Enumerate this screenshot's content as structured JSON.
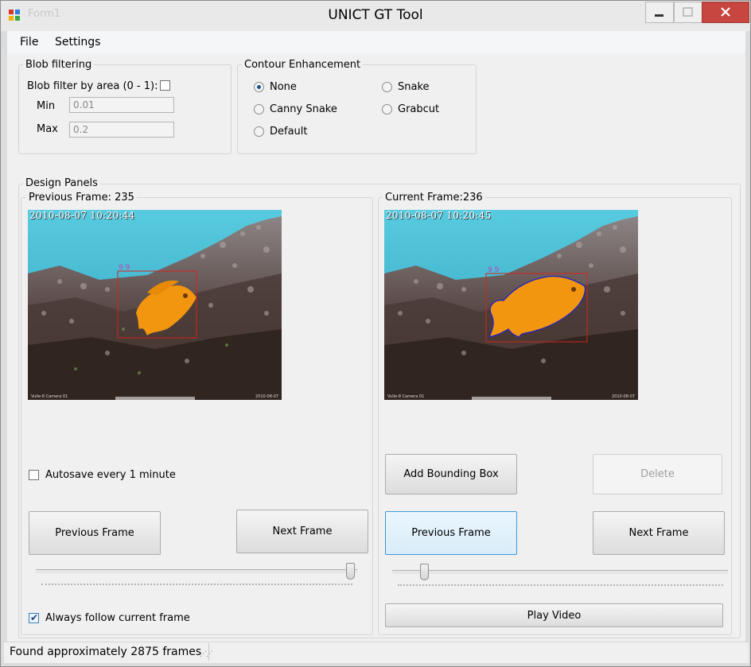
{
  "window": {
    "title": "UNICT GT Tool",
    "faded_title": "Form1"
  },
  "menu": {
    "items": [
      "File",
      "Settings"
    ]
  },
  "blob_filtering": {
    "label": "Blob filtering",
    "filter_label": "Blob filter by area (0 - 1):",
    "filter_checked": false,
    "min_label": "Min",
    "min_value": "0.01",
    "max_label": "Max",
    "max_value": "0.2"
  },
  "contour": {
    "label": "Contour Enhancement",
    "options": [
      "None",
      "Canny Snake",
      "Default",
      "Snake",
      "Grabcut"
    ],
    "selected": "None"
  },
  "design_panels": {
    "label": "Design Panels",
    "left": {
      "header": "Previous Frame: 235",
      "timestamp": "2010-08-07 10:20:44",
      "autosave_label": "Autosave every 1 minute",
      "autosave_checked": false,
      "prev_button": "Previous Frame",
      "next_button": "Next Frame",
      "slider_value": 0.99,
      "follow_label": "Always follow current frame",
      "follow_checked": true
    },
    "right": {
      "header": "Current Frame:236",
      "timestamp": "2010-08-07 10:20:45",
      "add_bbox_button": "Add Bounding Box",
      "delete_button": "Delete",
      "prev_button": "Previous Frame",
      "next_button": "Next Frame",
      "slider_value": 0.08,
      "play_button": "Play Video"
    }
  },
  "status": {
    "text": "Found approximately 2875 frames"
  },
  "colors": {
    "water": "#3fb9d4",
    "fish": "#f0900c",
    "bbox": "#d4231b",
    "contour": "#2020c8"
  }
}
